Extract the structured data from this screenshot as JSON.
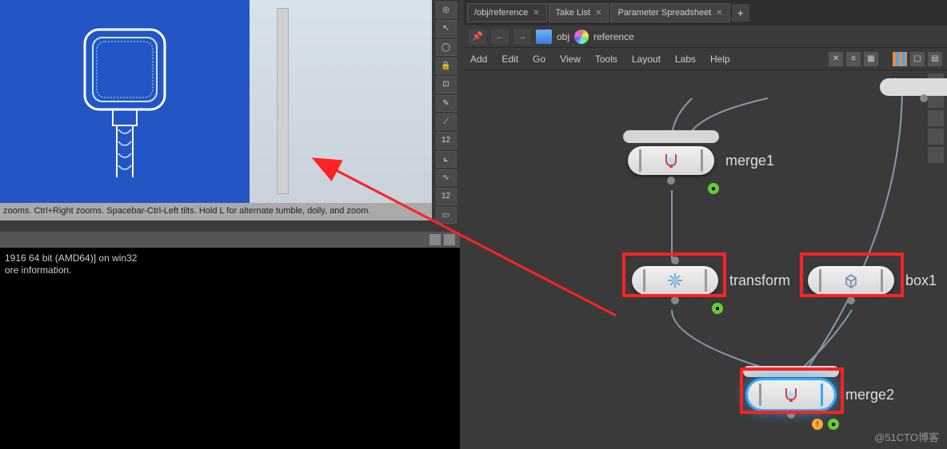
{
  "viewport": {
    "status_text": "zooms. Ctrl+Right zooms. Spacebar-Ctrl-Left tilts. Hold L for alternate tumble, dolly, and zoom."
  },
  "vtool_label_num": "12",
  "console": {
    "line1": "1916 64 bit (AMD64)] on win32",
    "line2": "ore information."
  },
  "tabs": [
    {
      "label": "/obj/reference",
      "active": true
    },
    {
      "label": "Take List",
      "active": false
    },
    {
      "label": "Parameter Spreadsheet",
      "active": false
    }
  ],
  "path": {
    "obj": "obj",
    "node": "reference"
  },
  "menu": [
    "Add",
    "Edit",
    "Go",
    "View",
    "Tools",
    "Layout",
    "Labs",
    "Help"
  ],
  "nodes": {
    "merge1": "merge1",
    "transform1": "transform",
    "box1": "box1",
    "merge2": "merge2"
  },
  "watermark": "@51CTO博客"
}
